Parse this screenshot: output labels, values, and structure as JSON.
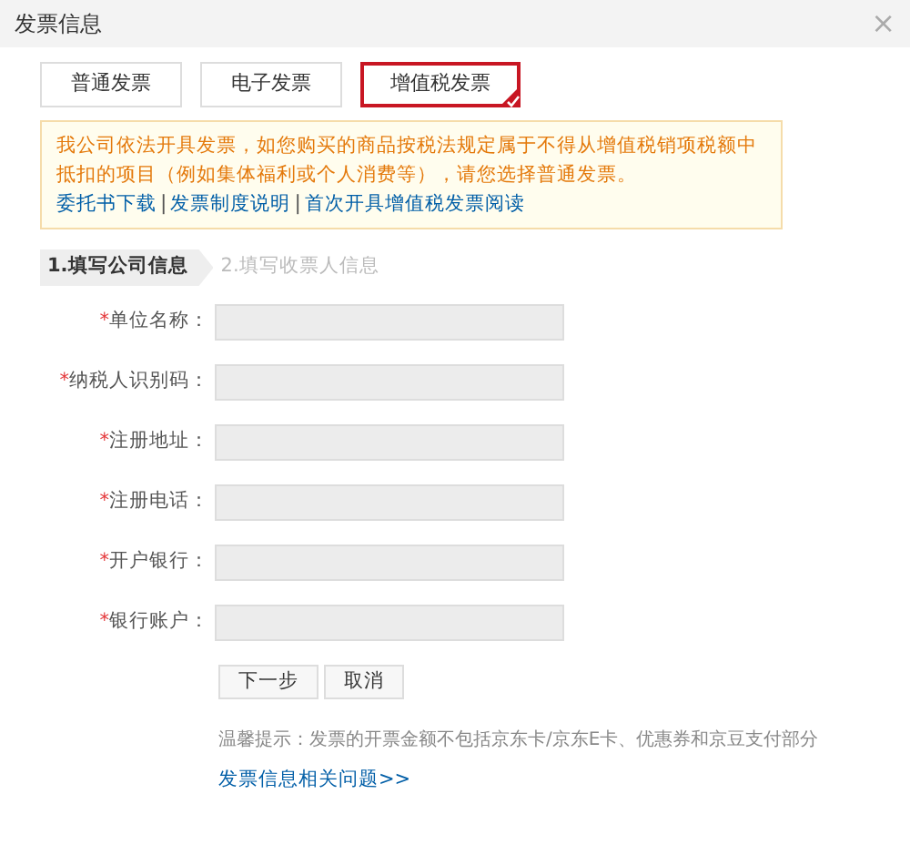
{
  "window": {
    "title": "发票信息",
    "close": "×"
  },
  "tabs": [
    {
      "label": "普通发票",
      "selected": false
    },
    {
      "label": "电子发票",
      "selected": false
    },
    {
      "label": "增值税发票",
      "selected": true
    }
  ],
  "notice": {
    "text": "我公司依法开具发票，如您购买的商品按税法规定属于不得从增值税销项税额中抵扣的项目（例如集体福利或个人消费等），请您选择普通发票。",
    "links": [
      "委托书下载",
      "发票制度说明",
      "首次开具增值税发票阅读"
    ],
    "separator": "|"
  },
  "steps": [
    {
      "label": "1.填写公司信息",
      "selected": true
    },
    {
      "label": "2.填写收票人信息",
      "selected": false
    }
  ],
  "fields": [
    {
      "label": "单位名称：",
      "required": true
    },
    {
      "label": "纳税人识别码：",
      "required": true
    },
    {
      "label": "注册地址：",
      "required": true
    },
    {
      "label": "注册电话：",
      "required": true
    },
    {
      "label": "开户银行：",
      "required": true
    },
    {
      "label": "银行账户：",
      "required": true
    }
  ],
  "required_mark": "*",
  "buttons": [
    "下一步",
    "取消"
  ],
  "tip": "温馨提示：发票的开票金额不包括京东卡/京东E卡、优惠券和京豆支付部分",
  "help_link": "发票信息相关问题>>"
}
